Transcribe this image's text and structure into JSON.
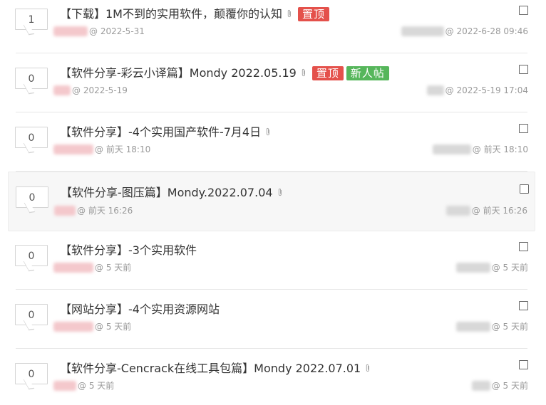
{
  "threads": [
    {
      "count": "1",
      "title": "【下载】1M不到的实用软件，颠覆你的认知",
      "badges": [
        {
          "label": "置顶",
          "color": "#e4514b"
        }
      ],
      "post_date": "@ 2022-5-31",
      "last_reply": "@ 2022-6-28 09:46",
      "has_attachment": true
    },
    {
      "count": "0",
      "title": "【软件分享-彩云小译篇】Mondy 2022.05.19",
      "badges": [
        {
          "label": "置顶",
          "color": "#e4514b"
        },
        {
          "label": "新人帖",
          "color": "#56b65b"
        }
      ],
      "post_date": "@ 2022-5-19",
      "last_reply": "@ 2022-5-19 17:04",
      "has_attachment": true
    },
    {
      "count": "0",
      "title": "【软件分享】-4个实用国产软件-7月4日",
      "badges": [],
      "post_date": "@ 前天 18:10",
      "last_reply": "@ 前天 18:10",
      "has_attachment": true
    },
    {
      "count": "0",
      "title": "【软件分享-图压篇】Mondy.2022.07.04",
      "badges": [],
      "post_date": "@ 前天 16:26",
      "last_reply": "@ 前天 16:26",
      "has_attachment": true
    },
    {
      "count": "0",
      "title": "【软件分享】-3个实用软件",
      "badges": [],
      "post_date": "@ 5 天前",
      "last_reply": "@ 5 天前",
      "has_attachment": false
    },
    {
      "count": "0",
      "title": "【网站分享】-4个实用资源网站",
      "badges": [],
      "post_date": "@ 5 天前",
      "last_reply": "@ 5 天前",
      "has_attachment": false
    },
    {
      "count": "0",
      "title": "【软件分享-Cencrack在线工具包篇】Mondy 2022.07.01",
      "badges": [],
      "post_date": "@ 5 天前",
      "last_reply": "@ 5 天前",
      "has_attachment": true
    }
  ],
  "icons": {
    "attachment": "paperclip-icon",
    "select": "checkbox"
  }
}
